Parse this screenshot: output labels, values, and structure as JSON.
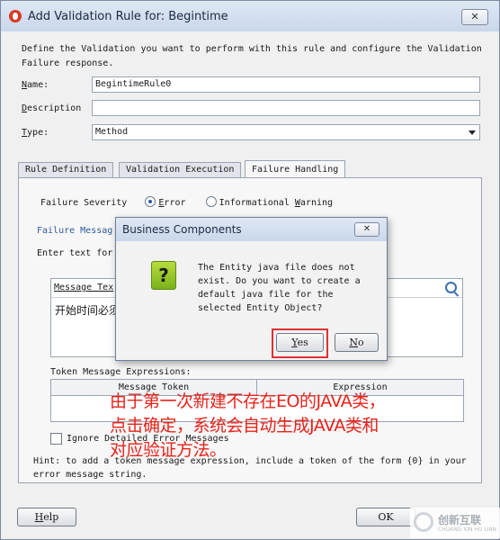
{
  "window": {
    "title": "Add Validation Rule for: Begintime",
    "close_label": "✕"
  },
  "intro_text": "Define the Validation you want to perform with this rule and configure the Validation\nFailure response.",
  "form": {
    "name_label_key": "N",
    "name_label_rest": "ame:",
    "name_value": "BegintimeRule0",
    "description_label_key": "D",
    "description_label_rest": "escription",
    "description_value": "",
    "type_label_key": "T",
    "type_label_rest": "ype:",
    "type_value": "Method"
  },
  "tabs": [
    {
      "label": "Rule Definition"
    },
    {
      "label": "Validation Execution"
    },
    {
      "label": "Failure Handling"
    }
  ],
  "failure": {
    "severity_label": "Failure Severity",
    "error_key": "E",
    "error_rest": "rror",
    "warning_lead": "Informational ",
    "warning_key": "W",
    "warning_rest": "arning",
    "message_heading": "Failure Messag",
    "enter_text": "Enter text for",
    "message_text_header": "Message Tex",
    "message_content": "开始时间必须",
    "token_label": "Token Message Expressions:",
    "token_col_1": "Message Token",
    "token_col_2": "Expression",
    "ignore_label": "Ignore Detailed Error Messages",
    "hint_text": "Hint: to add a token message expression, include a token of the form {0} in your\nerror message string."
  },
  "buttons": {
    "help_key": "H",
    "help_rest": "elp",
    "ok_label": "OK"
  },
  "dialog": {
    "title": "Business Components",
    "close_label": "✕",
    "icon_glyph": "?",
    "message": "The Entity java file does not\nexist. Do you want to create a\ndefault java file for the\nselected Entity Object?",
    "yes_key": "Y",
    "yes_rest": "es",
    "no_key": "N",
    "no_rest": "o"
  },
  "annotation": "由于第一次新建不存在EO的JAVA类，\n点击确定，系统会自动生成JAVA类和\n对应验证方法。",
  "watermark": {
    "text": "创新互联",
    "subtext": "CHUANG XIN HU LIAN"
  },
  "colors": {
    "annotation": "#e8231b",
    "highlight": "#e03030",
    "icon": "#8cc63f"
  }
}
